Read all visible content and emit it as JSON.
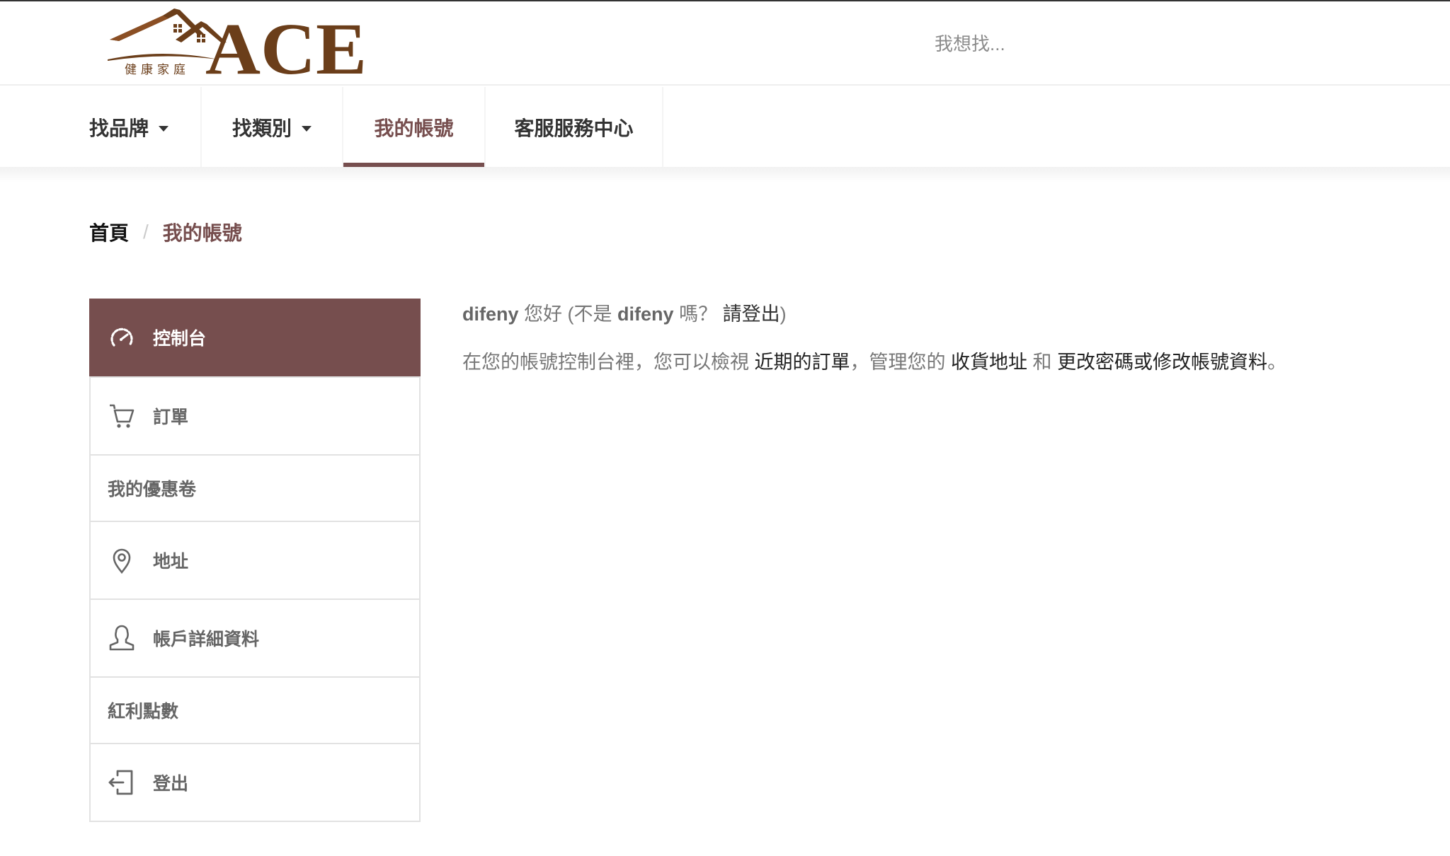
{
  "brand": {
    "name": "ACE",
    "tagline": "健康家庭",
    "color": "#6b3e1a"
  },
  "search": {
    "placeholder": "我想找..."
  },
  "nav": {
    "items": [
      {
        "label": "找品牌",
        "dropdown": true
      },
      {
        "label": "找類別",
        "dropdown": true
      },
      {
        "label": "我的帳號",
        "active": true
      },
      {
        "label": "客服服務中心"
      }
    ]
  },
  "breadcrumb": {
    "home": "首頁",
    "separator": "/",
    "current": "我的帳號"
  },
  "sidebar": {
    "items": [
      {
        "label": "控制台",
        "icon": "dashboard-icon",
        "active": true
      },
      {
        "label": "訂單",
        "icon": "cart-icon"
      },
      {
        "label": "我的優惠卷",
        "icon": null
      },
      {
        "label": "地址",
        "icon": "location-pin-icon"
      },
      {
        "label": "帳戶詳細資料",
        "icon": "user-icon"
      },
      {
        "label": "紅利點數",
        "icon": null
      },
      {
        "label": "登出",
        "icon": "logout-icon"
      }
    ]
  },
  "main": {
    "greeting": {
      "username": "difeny",
      "hello": "您好 (不是",
      "username2": "difeny",
      "question": "嗎？",
      "logout_link": "請登出",
      "close": ")"
    },
    "description": {
      "part1": "在您的帳號控制台裡，您可以檢視",
      "link_orders": "近期的訂單",
      "part2": "，管理您的",
      "link_address": "收貨地址",
      "part3": "和",
      "link_account": "更改密碼或修改帳號資料",
      "end": "。"
    }
  },
  "colors": {
    "accent": "#764e4e",
    "text": "#333333",
    "muted": "#777777",
    "border": "#e2e2e2"
  }
}
